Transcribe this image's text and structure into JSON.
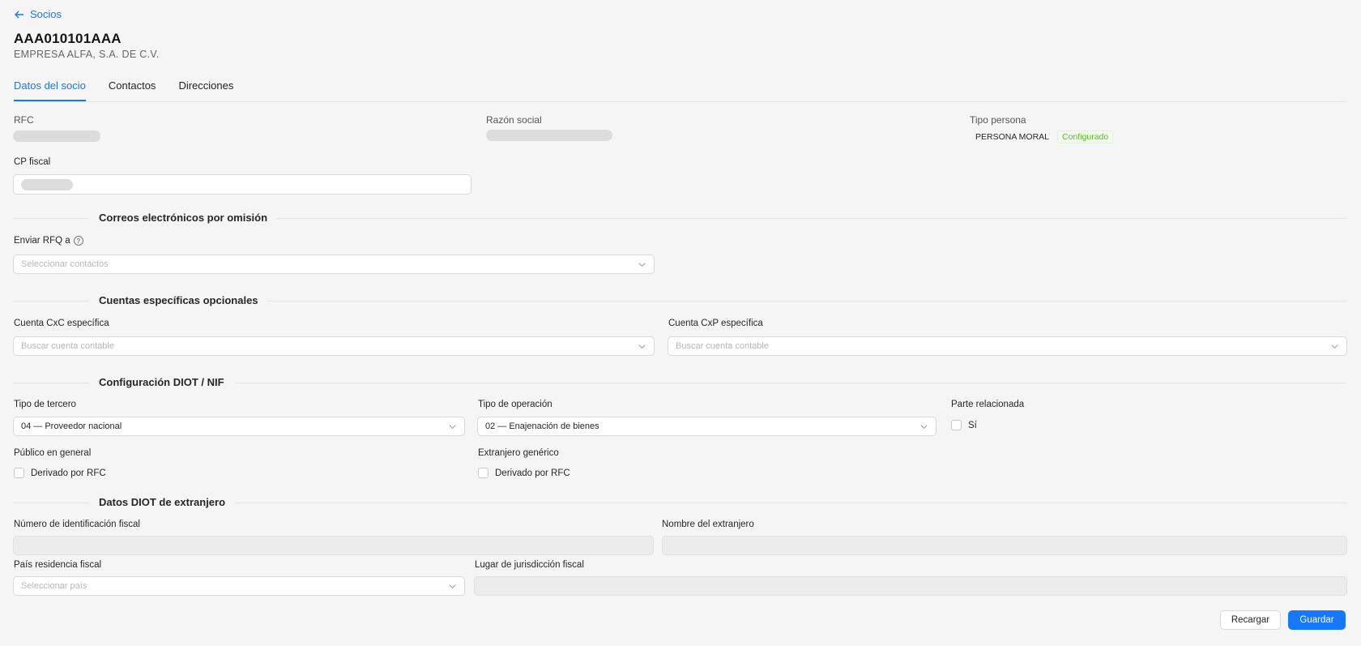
{
  "nav": {
    "back_label": "Socios"
  },
  "header": {
    "rfc": "AAA010101AAA",
    "company_name": "EMPRESA ALFA, S.A. DE C.V."
  },
  "tabs": [
    {
      "label": "Datos del socio",
      "active": true
    },
    {
      "label": "Contactos",
      "active": false
    },
    {
      "label": "Direcciones",
      "active": false
    }
  ],
  "info": {
    "rfc_label": "RFC",
    "razon_social_label": "Razón social",
    "tipo_persona_label": "Tipo persona",
    "tipo_persona_value": "PERSONA MORAL",
    "tipo_persona_badge": "Configurado",
    "cp_fiscal_label": "CP fiscal"
  },
  "correos": {
    "title": "Correos electrónicos por omisión",
    "enviar_rfq_label": "Enviar RFQ a",
    "help_glyph": "?",
    "select_placeholder": "Seleccionar contactos"
  },
  "cuentas": {
    "title": "Cuentas específicas opcionales",
    "cxc_label": "Cuenta CxC específica",
    "cxc_placeholder": "Buscar cuenta contable",
    "cxp_label": "Cuenta CxP específica",
    "cxp_placeholder": "Buscar cuenta contable"
  },
  "diot": {
    "title": "Configuración DIOT / NIF",
    "tipo_tercero_label": "Tipo de tercero",
    "tipo_tercero_value": "04 — Proveedor nacional",
    "tipo_operacion_label": "Tipo de operación",
    "tipo_operacion_value": "02 — Enajenación de bienes",
    "parte_relacionada_label": "Parte relacionada",
    "parte_relacionada_option": "Sí",
    "publico_general_label": "Público en general",
    "publico_general_option": "Derivado por RFC",
    "extranjero_generico_label": "Extranjero genérico",
    "extranjero_generico_option": "Derivado por RFC"
  },
  "extranjero": {
    "title": "Datos DIOT de extranjero",
    "nif_label": "Número de identificación fiscal",
    "nombre_label": "Nombre del extranjero",
    "pais_label": "País residencia fiscal",
    "pais_placeholder": "Seleccionar país",
    "lugar_label": "Lugar de jurisdicción fiscal"
  },
  "actions": {
    "reload_label": "Recargar",
    "save_label": "Guardar"
  },
  "colors": {
    "accent": "#1677ff",
    "success": "#52c41a",
    "background": "#f5f5f5"
  },
  "icons": {
    "back": "arrow-left-icon",
    "dropdown": "chevron-down-icon",
    "help": "question-circle-icon"
  }
}
